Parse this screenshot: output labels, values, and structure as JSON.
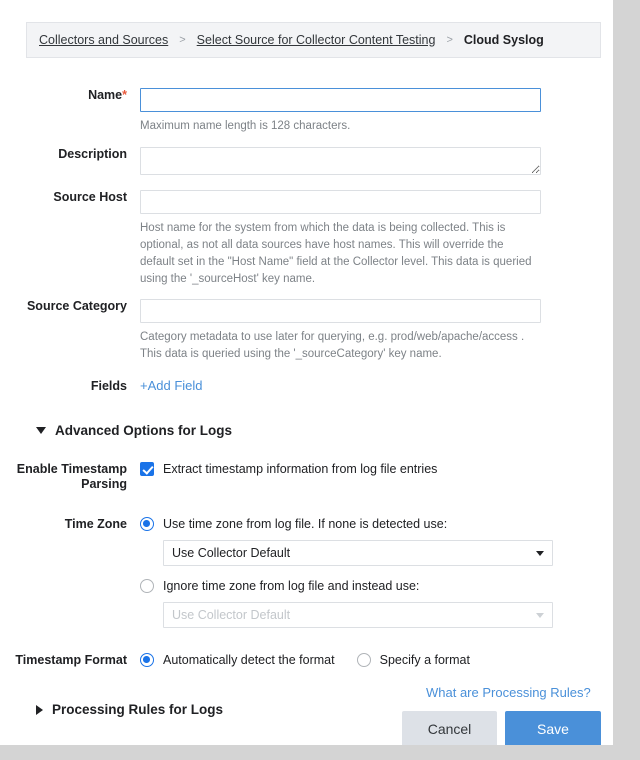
{
  "breadcrumb": {
    "items": [
      {
        "label": "Collectors and Sources",
        "type": "link"
      },
      {
        "label": "Select Source for Collector Content Testing",
        "type": "link"
      },
      {
        "label": "Cloud Syslog",
        "type": "current"
      }
    ],
    "separator": ">"
  },
  "form": {
    "name": {
      "label": "Name",
      "required_marker": "*",
      "value": "",
      "placeholder": "",
      "help": "Maximum name length is 128 characters."
    },
    "description": {
      "label": "Description",
      "value": "",
      "placeholder": ""
    },
    "source_host": {
      "label": "Source Host",
      "value": "",
      "placeholder": "",
      "help": "Host name for the system from which the data is being collected. This is optional, as not all data sources have host names. This will override the default set in the \"Host Name\" field at the Collector level. This data is queried using the '_sourceHost' key name."
    },
    "source_category": {
      "label": "Source Category",
      "value": "",
      "placeholder": "",
      "help": "Category metadata to use later for querying, e.g. prod/web/apache/access . This data is queried using the '_sourceCategory' key name."
    },
    "fields": {
      "label": "Fields",
      "add_link": "+Add Field"
    }
  },
  "advanced": {
    "title": "Advanced Options for Logs",
    "expanded": true,
    "timestamp_parsing": {
      "label": "Enable Timestamp Parsing",
      "checkbox_label": "Extract timestamp information from log file entries",
      "checked": true
    },
    "time_zone": {
      "label": "Time Zone",
      "option_use": {
        "label": "Use time zone from log file. If none is detected use:",
        "selected": true,
        "dropdown_value": "Use Collector Default",
        "disabled": false
      },
      "option_ignore": {
        "label": "Ignore time zone from log file and instead use:",
        "selected": false,
        "dropdown_value": "Use Collector Default",
        "disabled": true
      }
    },
    "timestamp_format": {
      "label": "Timestamp Format",
      "option_auto": {
        "label": "Automatically detect the format",
        "selected": true
      },
      "option_specify": {
        "label": "Specify a format",
        "selected": false
      }
    }
  },
  "processing_rules": {
    "title": "Processing Rules for Logs",
    "expanded": false,
    "help_link": "What are Processing Rules?"
  },
  "footer": {
    "cancel_label": "Cancel",
    "save_label": "Save"
  },
  "colors": {
    "accent_blue": "#4a90d9",
    "control_blue": "#1a73e8",
    "required_red": "#e8583a",
    "cancel_gray": "#dde1e7"
  }
}
